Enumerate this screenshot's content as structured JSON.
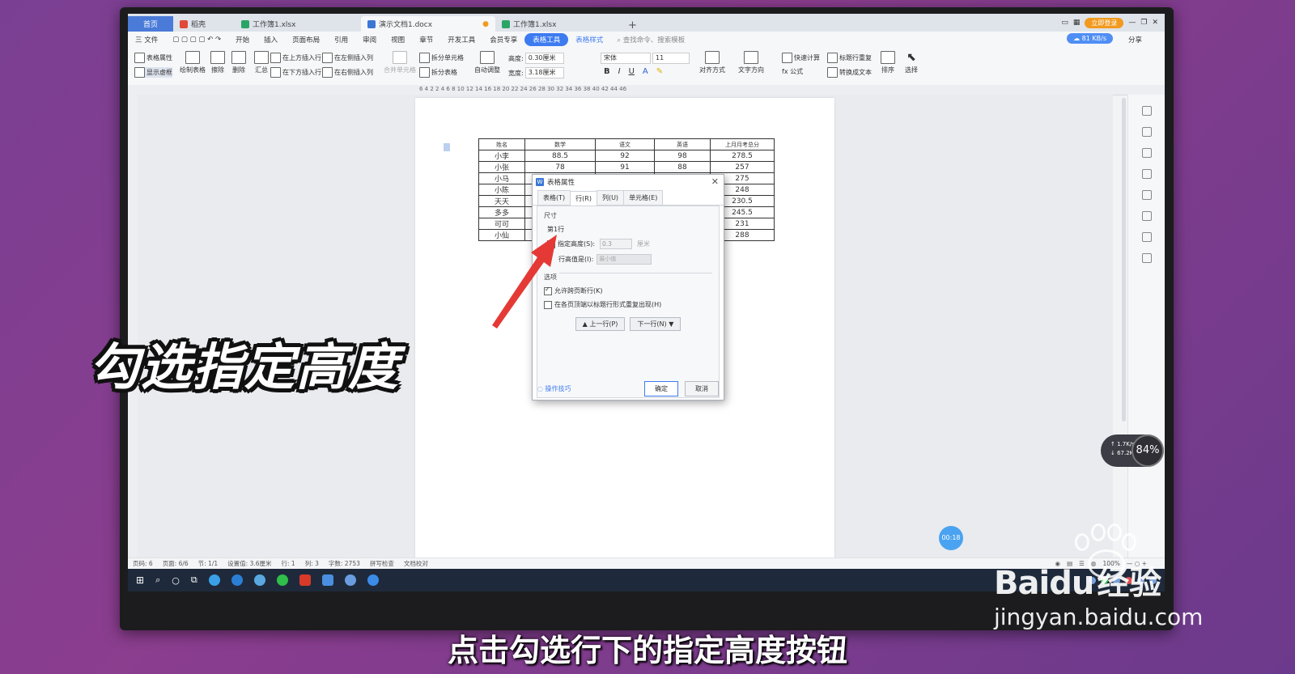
{
  "tabs": [
    {
      "label": "首页",
      "kind": "home"
    },
    {
      "label": "稻壳",
      "color": "#e04a3a"
    },
    {
      "label": "工作簿1.xlsx",
      "color": "#2aa567"
    },
    {
      "label": "演示文档1.docx",
      "color": "#3b77d6"
    },
    {
      "label": "工作簿1.xlsx",
      "color": "#2aa567"
    }
  ],
  "titlebar": {
    "login": "立即登录"
  },
  "menu": {
    "file": "三 文件",
    "items": [
      "开始",
      "插入",
      "页面布局",
      "引用",
      "审阅",
      "视图",
      "章节",
      "开发工具",
      "会员专享"
    ],
    "table_tools": "表格工具",
    "table_style": "表格样式",
    "search": "查找命令、搜索模板",
    "sync": "81 KB/s",
    "share": "分享"
  },
  "ribbon": {
    "table_props": "表格属性",
    "show_gridlines": "显示虚框",
    "draw_table": "绘制表格",
    "erase": "擦除",
    "delete": "删除",
    "summary": "汇总",
    "insert_above": "在上方插入行",
    "insert_below": "在下方插入行",
    "insert_left": "在左侧插入列",
    "insert_right": "在右侧插入列",
    "merge_cells": "合并单元格",
    "split_cells": "拆分单元格",
    "split_table": "拆分表格",
    "auto_fit": "自动调整",
    "height_label": "高度:",
    "height_value": "0.30厘米",
    "width_label": "宽度:",
    "width_value": "3.18厘米",
    "font": "宋体",
    "font_size": "11",
    "align": "对齐方式",
    "text_dir": "文字方向",
    "quick_calc": "快速计算",
    "title_repeat": "标题行重复",
    "to_text": "转换成文本",
    "formula": "fx 公式",
    "sort": "排序",
    "select": "选择"
  },
  "ruler_numbers": "6 4 2 2 4 6 8 10 12 14 16 18 20 22 24 26 28 30 32 34 36 38 40 42 44 46",
  "table": {
    "header": [
      "姓名",
      "数学",
      "语文",
      "英语",
      "上月月考总分"
    ],
    "rows": [
      [
        "小李",
        "88.5",
        "92",
        "98",
        "278.5"
      ],
      [
        "小张",
        "78",
        "91",
        "88",
        "257"
      ],
      [
        "小马",
        "",
        "",
        "",
        "275"
      ],
      [
        "小陈",
        "",
        "",
        "",
        "248"
      ],
      [
        "天天",
        "",
        "",
        "",
        "230.5"
      ],
      [
        "多多",
        "",
        "",
        "",
        "245.5"
      ],
      [
        "可可",
        "",
        "",
        "",
        "231"
      ],
      [
        "小仙",
        "",
        "",
        "",
        "288"
      ]
    ]
  },
  "dialog": {
    "title": "表格属性",
    "tabs": [
      "表格(T)",
      "行(R)",
      "列(U)",
      "单元格(E)"
    ],
    "section_size": "尺寸",
    "row_label": "第1行",
    "specify_height": "指定高度(S):",
    "height_value": "0.3",
    "unit": "厘米",
    "row_height_is": "行高值是(I):",
    "row_height_mode": "最小值",
    "section_options": "选项",
    "allow_break": "允许跨页断行(K)",
    "repeat_header": "在各页顶端以标题行形式重复出现(H)",
    "prev_row": "▲ 上一行(P)",
    "next_row": "下一行(N) ▼",
    "tips": "操作技巧",
    "ok": "确定",
    "cancel": "取消",
    "allow_break_checked": true,
    "repeat_header_checked": false,
    "specify_height_checked": false
  },
  "statusbar": {
    "items": [
      "页码: 6",
      "页面: 6/6",
      "节: 1/1",
      "设置值: 3.6厘米",
      "行: 1",
      "列: 3",
      "字数: 2753",
      "拼写检查",
      "文档校对"
    ],
    "zoom": "100%"
  },
  "overlay": {
    "caption": "勾选指定高度",
    "subtitle": "点击勾选行下的指定高度按钮",
    "timer": "00:18",
    "net_up": "↑ 1.7K/s",
    "net_down": "↓ 67.2K/s",
    "cpu": "84%",
    "wm_brand": "Bai",
    "wm_du": "du",
    "wm_jingyan": "经验",
    "wm_url": "jingyan.baidu.com"
  }
}
